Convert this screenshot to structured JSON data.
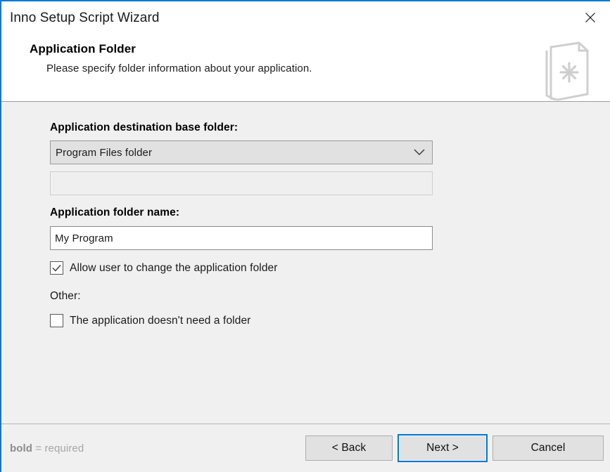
{
  "window": {
    "title": "Inno Setup Script Wizard",
    "close_icon": "close-icon",
    "accent_color": "#0078d7",
    "body_background": "#f0f0f0",
    "header_background": "#ffffff"
  },
  "header": {
    "title": "Application Folder",
    "subtitle": "Please specify folder information about your application.",
    "icon": "document-pages-asterisk-icon"
  },
  "form": {
    "base_folder_label": "Application destination base folder:",
    "base_folder_value": "Program Files folder",
    "base_folder_dropdown_icon": "chevron-down-icon",
    "custom_folder_value": "",
    "custom_folder_placeholder": "",
    "folder_name_label": "Application folder name:",
    "folder_name_value": "My Program",
    "allow_change_label": "Allow user to change the application folder",
    "allow_change_checked": true,
    "other_label": "Other:",
    "no_folder_label": "The application doesn't need a folder",
    "no_folder_checked": false
  },
  "footer": {
    "required_bold": "bold",
    "required_rest": " = required",
    "back_label": "< Back",
    "next_label": "Next >",
    "cancel_label": "Cancel"
  }
}
